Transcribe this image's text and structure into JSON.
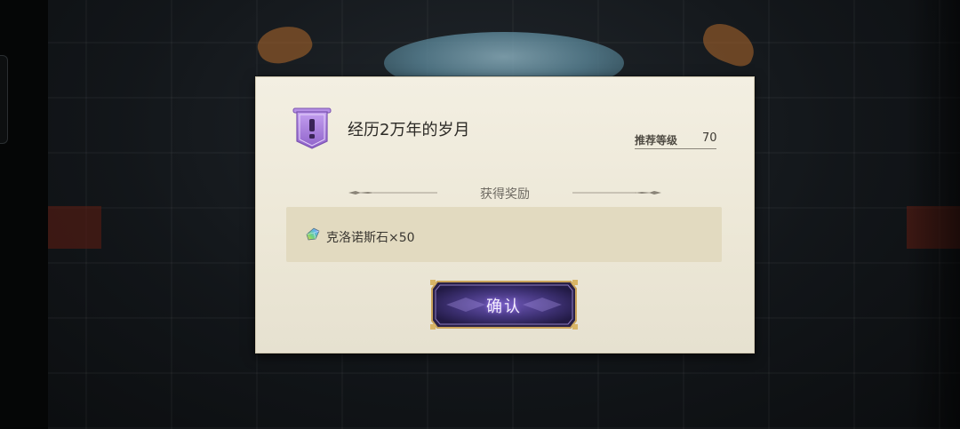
{
  "quest": {
    "title": "经历2万年的岁月",
    "level_label": "推荐等级",
    "level_value": "70"
  },
  "rewards": {
    "heading": "获得奖励",
    "items": [
      {
        "label": "克洛诺斯石×50",
        "icon": "rainbow-crystal-icon"
      }
    ]
  },
  "actions": {
    "confirm_label": "确认"
  },
  "colors": {
    "dialog_bg": "#efeadb",
    "banner_purple": "#a77fd6",
    "reward_box": "#e2dac0",
    "button_purple": "#4a3d82",
    "button_border": "#c9a35a"
  }
}
